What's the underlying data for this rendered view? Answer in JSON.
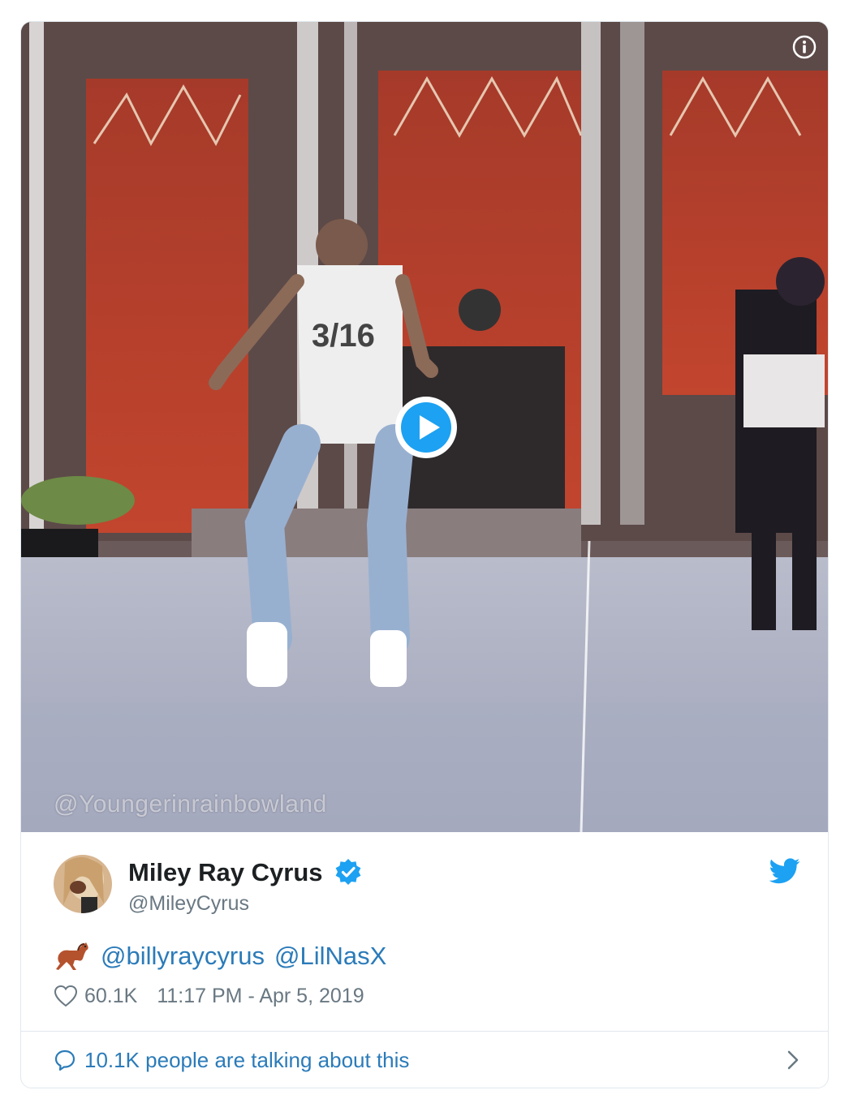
{
  "media": {
    "watermark": "@Youngerinrainbowland",
    "info_icon": "info-icon",
    "play_icon": "play-icon"
  },
  "author": {
    "name": "Miley Ray Cyrus",
    "handle": "@MileyCyrus",
    "verified_icon": "verified-badge-icon",
    "platform_icon": "twitter-bird-icon"
  },
  "tweet": {
    "emoji": "🐎",
    "mentions": [
      "@billyraycyrus",
      "@LilNasX"
    ]
  },
  "meta": {
    "likes": "60.1K",
    "timestamp": "11:17 PM - Apr 5, 2019"
  },
  "footer": {
    "talking_text": "10.1K people are talking about this"
  },
  "colors": {
    "link": "#2b7bb9",
    "verified": "#1da1f2",
    "text": "#1c2022",
    "muted": "#697882",
    "border": "#e1e8ed"
  }
}
